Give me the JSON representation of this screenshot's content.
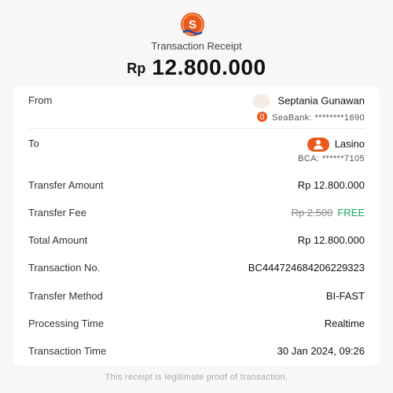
{
  "header": {
    "title": "Transaction Receipt",
    "currency": "Rp",
    "amount": "12.800.000"
  },
  "from": {
    "label": "From",
    "name": "Septania Gunawan",
    "bank": "SeaBank: ********1690"
  },
  "to": {
    "label": "To",
    "name": "Lasino",
    "bank": "BCA: ******7105"
  },
  "details": {
    "transfer_amount_label": "Transfer Amount",
    "transfer_amount_value": "Rp 12.800.000",
    "transfer_fee_label": "Transfer Fee",
    "transfer_fee_original": "Rp 2.500",
    "transfer_fee_value": "FREE",
    "total_amount_label": "Total Amount",
    "total_amount_value": "Rp 12.800.000",
    "transaction_no_label": "Transaction No.",
    "transaction_no_value": "BC444724684206229323",
    "transfer_method_label": "Transfer Method",
    "transfer_method_value": "BI-FAST",
    "processing_time_label": "Processing Time",
    "processing_time_value": "Realtime",
    "transaction_time_label": "Transaction Time",
    "transaction_time_value": "30 Jan 2024, 09:26"
  },
  "footer": {
    "note": "This receipt is legitimate proof of transaction."
  },
  "colors": {
    "brand": "#e8591c",
    "free": "#1aa260",
    "logo_wave": "#1f4fa8"
  },
  "icons": {
    "logo": "seabank-logo-icon",
    "from_avatar": "avatar-icon",
    "bank": "seabank-icon",
    "to_avatar": "user-icon"
  }
}
